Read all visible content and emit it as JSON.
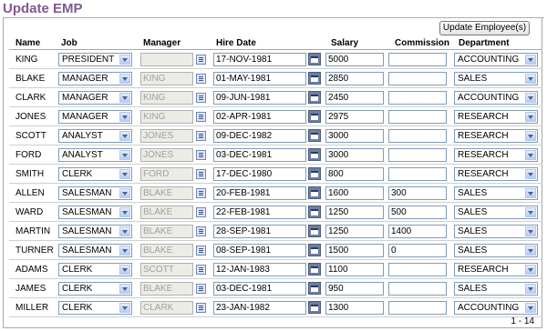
{
  "region_title": "Update EMP",
  "update_button_label": "Update Employee(s)",
  "columns": {
    "name": "Name",
    "job": "Job",
    "manager": "Manager",
    "hire_date": "Hire Date",
    "salary": "Salary",
    "commission": "Commission",
    "department": "Department"
  },
  "rows": [
    {
      "name": "KING",
      "job": "PRESIDENT",
      "manager": "",
      "hire_date": "17-NOV-1981",
      "salary": "5000",
      "commission": "",
      "department": "ACCOUNTING"
    },
    {
      "name": "BLAKE",
      "job": "MANAGER",
      "manager": "KING",
      "hire_date": "01-MAY-1981",
      "salary": "2850",
      "commission": "",
      "department": "SALES"
    },
    {
      "name": "CLARK",
      "job": "MANAGER",
      "manager": "KING",
      "hire_date": "09-JUN-1981",
      "salary": "2450",
      "commission": "",
      "department": "ACCOUNTING"
    },
    {
      "name": "JONES",
      "job": "MANAGER",
      "manager": "KING",
      "hire_date": "02-APR-1981",
      "salary": "2975",
      "commission": "",
      "department": "RESEARCH"
    },
    {
      "name": "SCOTT",
      "job": "ANALYST",
      "manager": "JONES",
      "hire_date": "09-DEC-1982",
      "salary": "3000",
      "commission": "",
      "department": "RESEARCH"
    },
    {
      "name": "FORD",
      "job": "ANALYST",
      "manager": "JONES",
      "hire_date": "03-DEC-1981",
      "salary": "3000",
      "commission": "",
      "department": "RESEARCH"
    },
    {
      "name": "SMITH",
      "job": "CLERK",
      "manager": "FORD",
      "hire_date": "17-DEC-1980",
      "salary": "800",
      "commission": "",
      "department": "RESEARCH"
    },
    {
      "name": "ALLEN",
      "job": "SALESMAN",
      "manager": "BLAKE",
      "hire_date": "20-FEB-1981",
      "salary": "1600",
      "commission": "300",
      "department": "SALES"
    },
    {
      "name": "WARD",
      "job": "SALESMAN",
      "manager": "BLAKE",
      "hire_date": "22-FEB-1981",
      "salary": "1250",
      "commission": "500",
      "department": "SALES"
    },
    {
      "name": "MARTIN",
      "job": "SALESMAN",
      "manager": "BLAKE",
      "hire_date": "28-SEP-1981",
      "salary": "1250",
      "commission": "1400",
      "department": "SALES"
    },
    {
      "name": "TURNER",
      "job": "SALESMAN",
      "manager": "BLAKE",
      "hire_date": "08-SEP-1981",
      "salary": "1500",
      "commission": "0",
      "department": "SALES"
    },
    {
      "name": "ADAMS",
      "job": "CLERK",
      "manager": "SCOTT",
      "hire_date": "12-JAN-1983",
      "salary": "1100",
      "commission": "",
      "department": "RESEARCH"
    },
    {
      "name": "JAMES",
      "job": "CLERK",
      "manager": "BLAKE",
      "hire_date": "03-DEC-1981",
      "salary": "950",
      "commission": "",
      "department": "SALES"
    },
    {
      "name": "MILLER",
      "job": "CLERK",
      "manager": "CLARK",
      "hire_date": "23-JAN-1982",
      "salary": "1300",
      "commission": "",
      "department": "ACCOUNTING"
    }
  ],
  "pagination_text": "1 - 14",
  "icons": {
    "select_arrow": "chevron-down-icon",
    "lov": "list-icon",
    "date_picker": "calendar-icon"
  },
  "colors": {
    "title": "#7e5a8e",
    "select_border": "#7f9db9",
    "readonly_bg": "#ecebe5"
  }
}
